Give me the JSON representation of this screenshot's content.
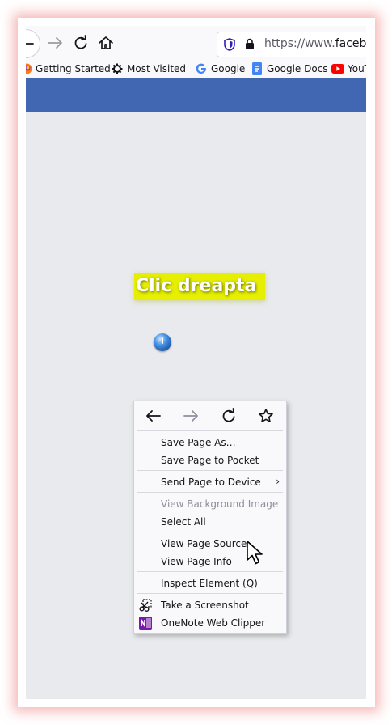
{
  "browser": {
    "url_prefix": "https://www.",
    "url_domain": "facebook",
    "bookmarks": [
      {
        "label": "Getting Started",
        "icon": "firefox-icon"
      },
      {
        "label": "Most Visited",
        "icon": "gear-icon"
      },
      {
        "label": "Google",
        "icon": "google-icon"
      },
      {
        "label": "Google Docs",
        "icon": "google-docs-icon"
      },
      {
        "label": "YouT",
        "icon": "youtube-icon"
      }
    ]
  },
  "page": {
    "highlight_text": "Clic dreapta",
    "brand_color": "#4267b2",
    "highlight_color": "#e6ef00"
  },
  "context_menu": {
    "items": {
      "save_page_as": "Save Page As…",
      "save_to_pocket": "Save Page to Pocket",
      "send_to_device": "Send Page to Device",
      "view_bg_image": "View Background Image",
      "select_all": "Select All",
      "view_source": "View Page Source",
      "view_info": "View Page Info",
      "inspect": "Inspect Element (Q)",
      "screenshot": "Take a Screenshot",
      "onenote": "OneNote Web Clipper"
    }
  }
}
